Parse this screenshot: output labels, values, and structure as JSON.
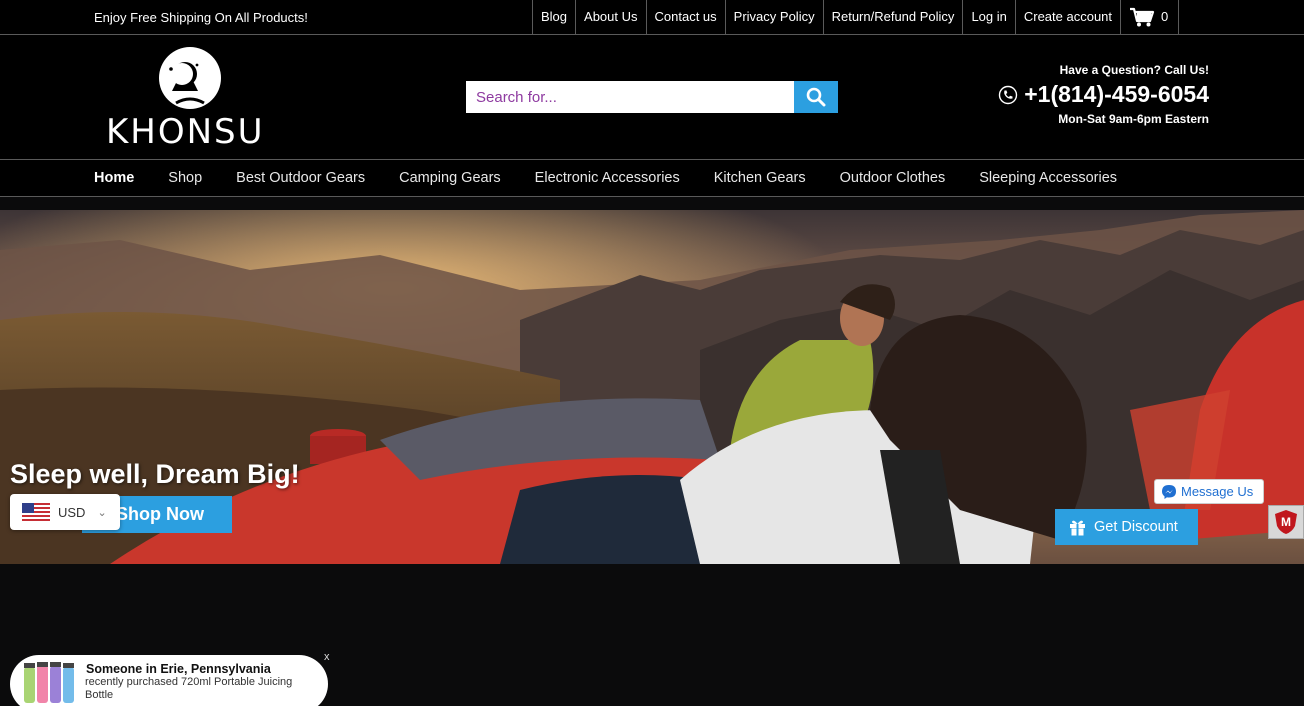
{
  "topbar": {
    "promo": "Enjoy Free Shipping On All Products!",
    "links": [
      "Blog",
      "About Us",
      "Contact us",
      "Privacy Policy",
      "Return/Refund Policy",
      "Log in",
      "Create account"
    ],
    "cart_count": "0",
    "cart_icon": "cart-icon"
  },
  "header": {
    "logo_text": "KHONSU",
    "search_placeholder": "Search for...",
    "search_icon": "search-icon",
    "contact_question": "Have a Question? Call Us!",
    "phone": "+1(814)-459-6054",
    "phone_icon": "phone-icon",
    "hours": "Mon-Sat 9am-6pm Eastern"
  },
  "nav": {
    "items": [
      "Home",
      "Shop",
      "Best Outdoor Gears",
      "Camping Gears",
      "Electronic Accessories",
      "Kitchen Gears",
      "Outdoor Clothes",
      "Sleeping Accessories"
    ],
    "active": "Home"
  },
  "hero": {
    "headline": "Sleep well, Dream Big!",
    "cta": "Shop Now"
  },
  "currency": {
    "code": "USD",
    "flag_icon": "us-flag-icon"
  },
  "widgets": {
    "messenger": "Message Us",
    "discount": "Get Discount",
    "badge": "M"
  },
  "popup": {
    "title": "Someone in Erie, Pennsylvania",
    "text": "recently purchased 720ml Portable Juicing Bottle",
    "close": "x"
  },
  "colors": {
    "accent": "#2c9fe0",
    "background": "#000000"
  }
}
